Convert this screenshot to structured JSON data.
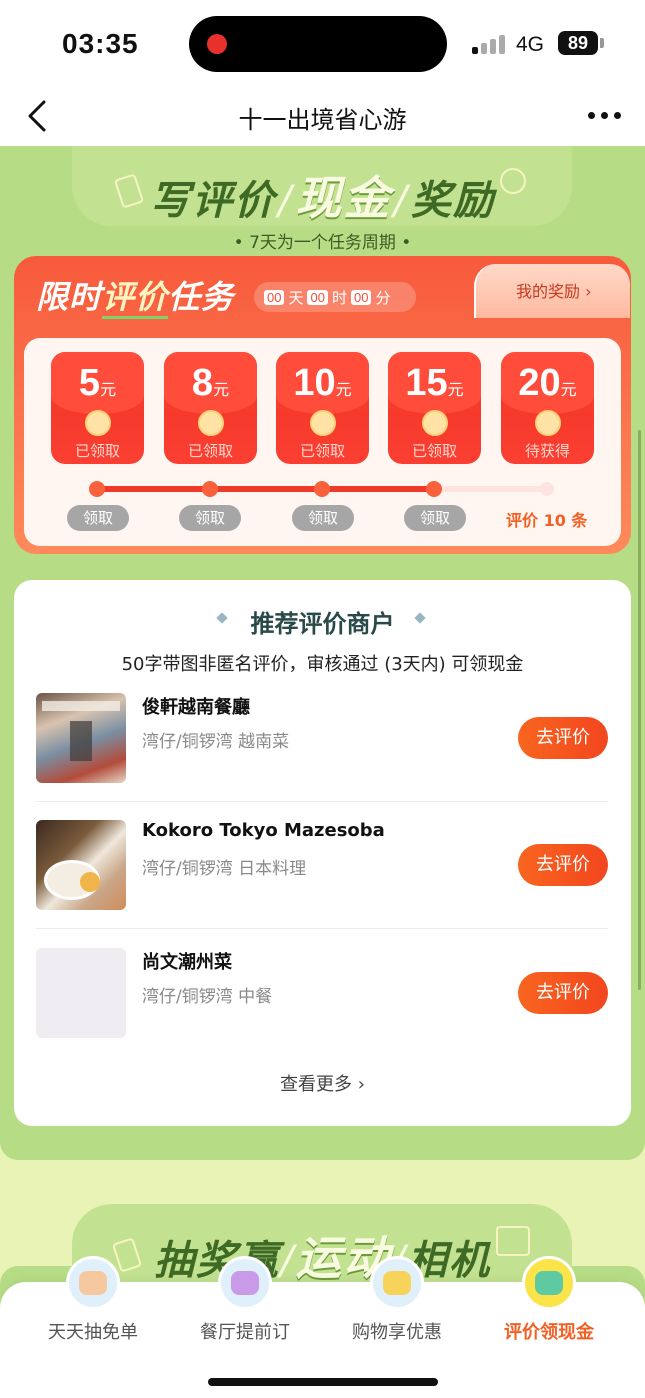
{
  "status_bar": {
    "time": "03:35",
    "network": "4G",
    "battery": "89"
  },
  "nav": {
    "title": "十一出境省心游"
  },
  "hero": {
    "title_part1": "写评价",
    "title_highlight": "现金",
    "title_part2": "奖励",
    "subtitle": "• 7天为一个任务周期 •"
  },
  "task": {
    "title_part1": "限时",
    "title_highlight": "评价",
    "title_part2": "任务",
    "countdown": {
      "days": "00",
      "days_label": "天",
      "hours": "00",
      "hours_label": "时",
      "minutes": "00",
      "minutes_label": "分"
    },
    "my_rewards": "我的奖励 ›",
    "unit": "元",
    "rewards": [
      {
        "amount": "5",
        "status": "已领取",
        "claim_label": "领取"
      },
      {
        "amount": "8",
        "status": "已领取",
        "claim_label": "领取"
      },
      {
        "amount": "10",
        "status": "已领取",
        "claim_label": "领取"
      },
      {
        "amount": "15",
        "status": "已领取",
        "claim_label": "领取"
      },
      {
        "amount": "20",
        "status": "待获得",
        "target_label": "评价 10 条"
      }
    ],
    "progress_steps_completed": 4,
    "progress_steps_total": 5
  },
  "merchants": {
    "title": "推荐评价商户",
    "description": "50字带图非匿名评价，审核通过 (3天内) 可领现金",
    "button_label": "去评价",
    "items": [
      {
        "name": "俊軒越南餐廳",
        "meta": "湾仔/铜锣湾  越南菜"
      },
      {
        "name": "Kokoro Tokyo Mazesoba",
        "meta": "湾仔/铜锣湾  日本料理"
      },
      {
        "name": "尚文潮州菜",
        "meta": "湾仔/铜锣湾  中餐"
      }
    ],
    "see_more": "查看更多 ›"
  },
  "promo": {
    "title_part1": "抽奖赢",
    "title_highlight": "运动",
    "title_part2": "相机"
  },
  "tabs": [
    {
      "label": "天天抽免单",
      "icon": "bear-icon",
      "active": false
    },
    {
      "label": "餐厅提前订",
      "icon": "sofa-icon",
      "active": false
    },
    {
      "label": "购物享优惠",
      "icon": "shopping-bag-icon",
      "active": false
    },
    {
      "label": "评价领现金",
      "icon": "notebook-icon",
      "active": true
    }
  ],
  "colors": {
    "accent": "#f26024",
    "panel_green": "#b6dd85",
    "task_red": "#f75a3c"
  }
}
